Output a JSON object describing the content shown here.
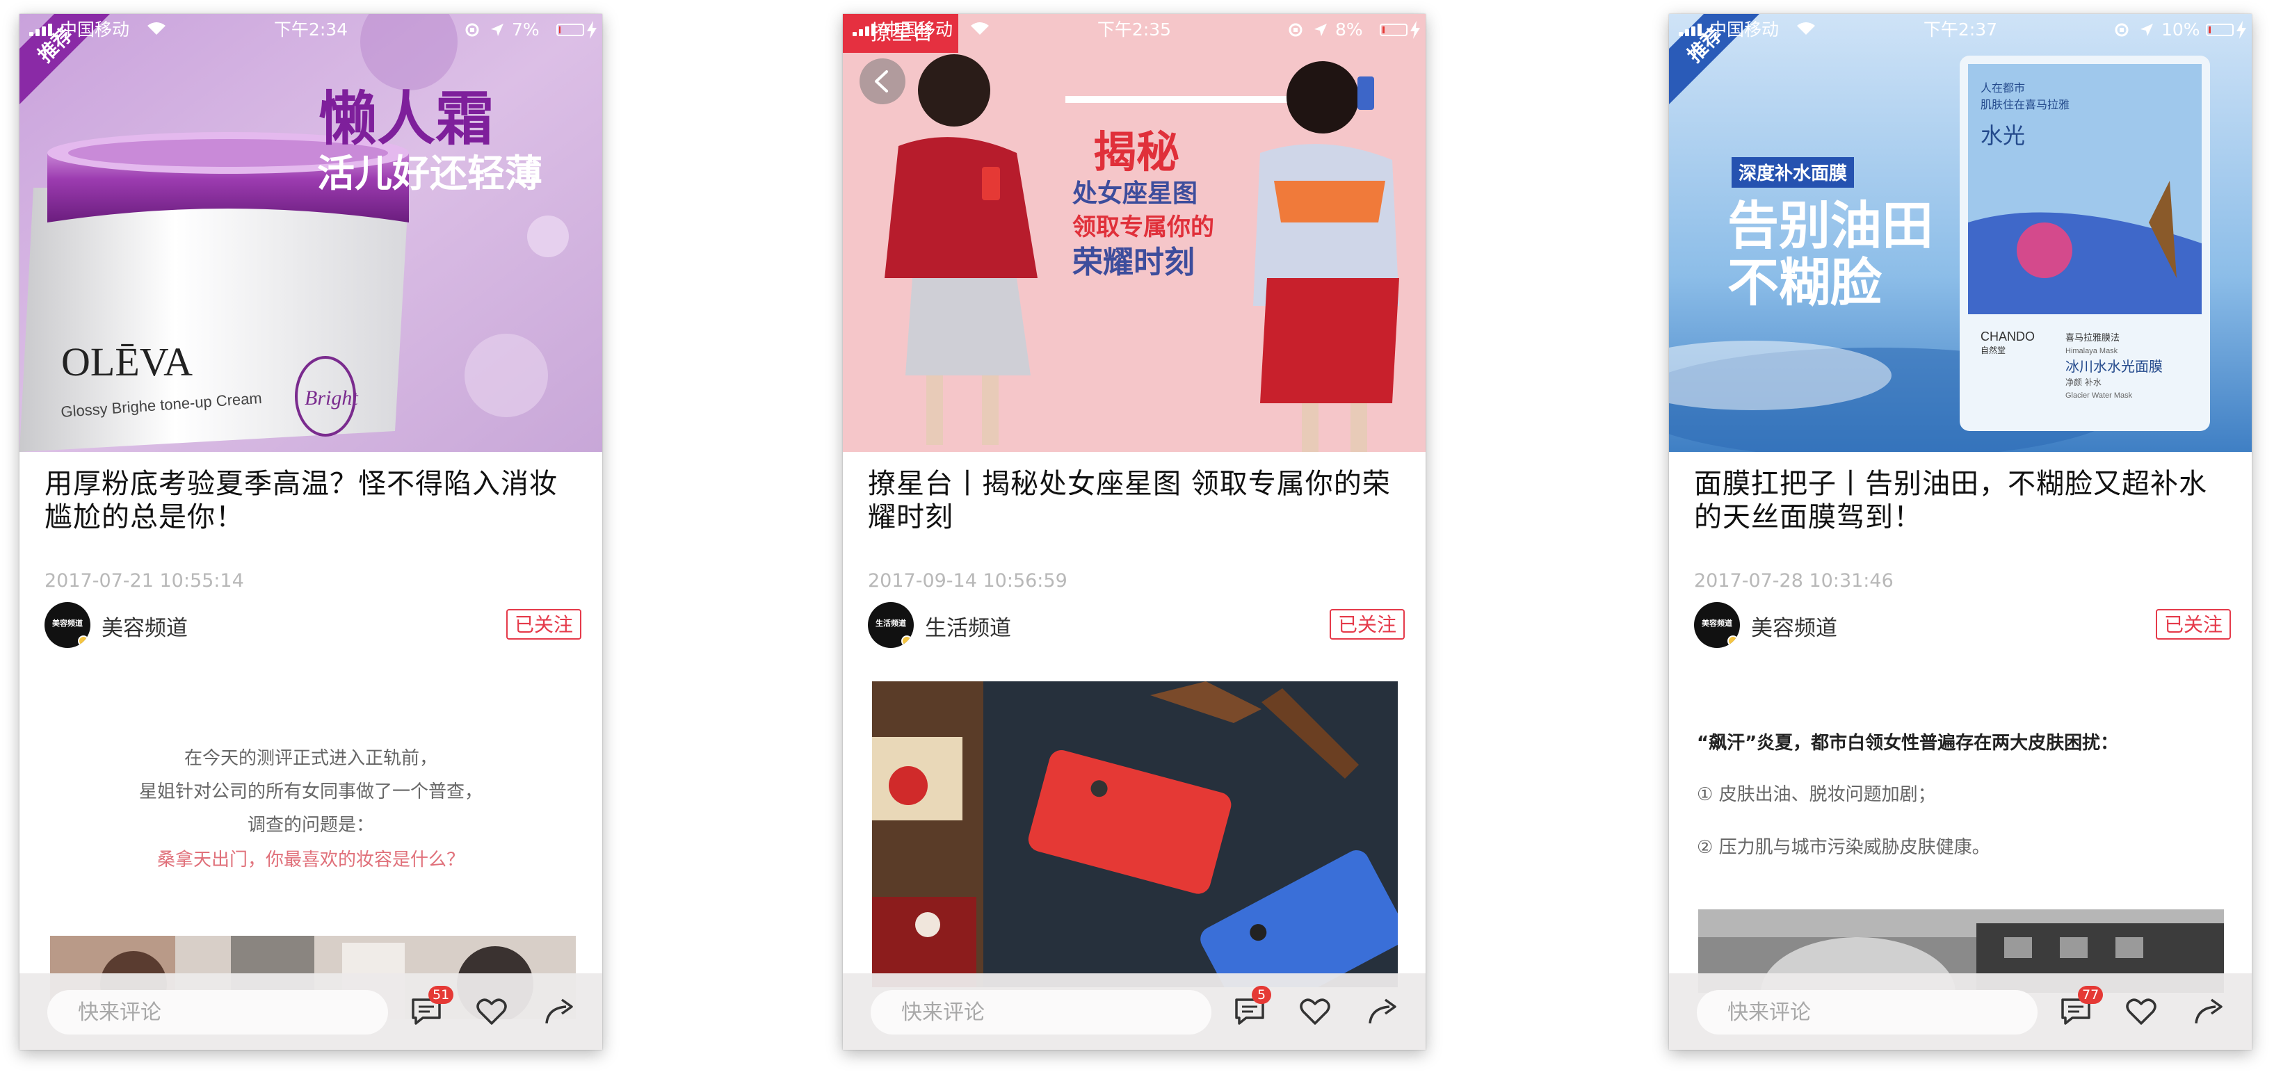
{
  "phones": [
    {
      "status": {
        "carrier": "中国移动",
        "time": "下午2:34",
        "battery": "7%",
        "battery_level": 0.07
      },
      "ribbon": "推荐",
      "hero": {
        "headline": "懒人霜",
        "subline": "活儿好还轻薄",
        "brand": "OLĒVA",
        "product_line": "Glossy Brighe tone-up Cream",
        "seal": "Bright"
      },
      "title": "用厚粉底考验夏季高温？怪不得陷入消妆尴尬的总是你！",
      "date": "2017-07-21 10:55:14",
      "author": {
        "avatar_text": "美容频道",
        "name": "美容频道"
      },
      "follow_label": "已关注",
      "body": {
        "lines": [
          "在今天的测评正式进入正轨前，",
          "星姐针对公司的所有女同事做了一个普查，",
          "调查的问题是："
        ],
        "highlight": "桑拿天出门，你最喜欢的妆容是什么？"
      },
      "bottom": {
        "placeholder": "快来评论",
        "comment_count": "51"
      }
    },
    {
      "status": {
        "carrier": "中国移动",
        "time": "下午2:35",
        "battery": "8%",
        "battery_level": 0.08
      },
      "ribbon": "撩星台",
      "hero": {
        "headline": "揭秘",
        "line2": "处女座星图",
        "line3": "领取专属你的",
        "line4": "荣耀时刻"
      },
      "title": "撩星台丨揭秘处女座星图 领取专属你的荣耀时刻",
      "date": "2017-09-14 10:56:59",
      "author": {
        "avatar_text": "生活频道",
        "name": "生活频道"
      },
      "follow_label": "已关注",
      "bottom": {
        "placeholder": "快来评论",
        "comment_count": "5"
      }
    },
    {
      "status": {
        "carrier": "中国移动",
        "time": "下午2:37",
        "battery": "10%",
        "battery_level": 0.1
      },
      "ribbon": "推荐",
      "hero": {
        "tag": "深度补水面膜",
        "headline1": "告别油田",
        "headline2": "不糊脸",
        "pack_top1": "人在都市",
        "pack_top2": "肌肤住在喜马拉雅",
        "pack_water": "水光",
        "pack_brand": "CHANDO",
        "pack_brand_cn": "自然堂",
        "pack_mid": "喜马拉雅膜法",
        "pack_sub": "Himalaya Mask",
        "pack_name": "冰川水水光面膜",
        "pack_name2": "净颜 补水",
        "pack_en": "Glacier Water Mask"
      },
      "title": "面膜扛把子丨告别油田，不糊脸又超补水的天丝面膜驾到！",
      "date": "2017-07-28 10:31:46",
      "author": {
        "avatar_text": "美容频道",
        "name": "美容频道"
      },
      "follow_label": "已关注",
      "body": {
        "lead": "“飙汗”炎夏，都市白领女性普遍存在两大皮肤困扰：",
        "item1": "① 皮肤出油、脱妆问题加剧；",
        "item2": "② 压力肌与城市污染威胁皮肤健康。"
      },
      "bottom": {
        "placeholder": "快来评论",
        "comment_count": "77"
      }
    }
  ],
  "colors": {
    "accent": "#e53a4a",
    "badge": "#e53935"
  },
  "icons": [
    "signal-icon",
    "wifi-icon",
    "rotation-lock-icon",
    "location-icon",
    "battery-icon",
    "charging-icon",
    "back-icon",
    "comment-icon",
    "heart-icon",
    "share-icon"
  ]
}
